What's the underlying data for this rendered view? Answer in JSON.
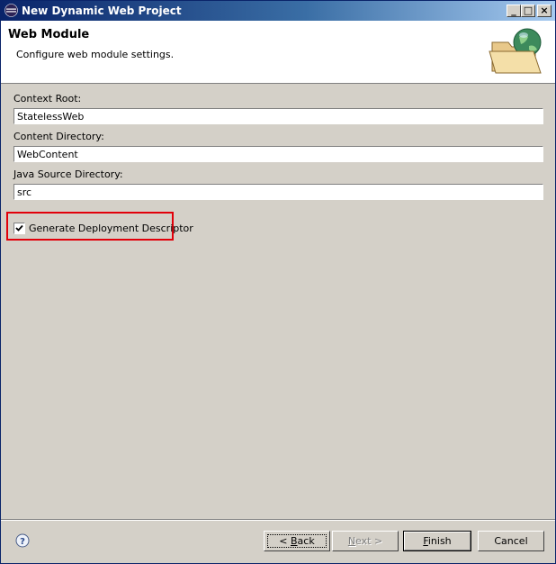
{
  "window": {
    "title": "New Dynamic Web Project",
    "controls": {
      "minimize": "_",
      "maximize": "□",
      "close": "×"
    }
  },
  "banner": {
    "title": "Web Module",
    "description": "Configure web module settings.",
    "graphic_icon": "folder-globe-icon"
  },
  "form": {
    "context_root": {
      "label": "Context Root:",
      "value": "StatelessWeb"
    },
    "content_directory": {
      "label": "Content Directory:",
      "value": "WebContent"
    },
    "java_source_directory": {
      "label": "Java Source Directory:",
      "value": "src"
    },
    "generate_descriptor": {
      "label": "Generate Deployment Descriptor",
      "checked": true
    }
  },
  "footer": {
    "help_icon": "help-icon",
    "back_prefix": "< ",
    "back_mnemonic": "B",
    "back_rest": "ack",
    "next_mnemonic": "N",
    "next_rest": "ext >",
    "finish_mnemonic": "F",
    "finish_rest": "inish",
    "cancel_label": "Cancel"
  },
  "colors": {
    "title_gradient_start": "#0a246a",
    "title_gradient_end": "#a6caf0",
    "highlight_border": "#e2000a",
    "dialog_bg": "#d4d0c8"
  }
}
